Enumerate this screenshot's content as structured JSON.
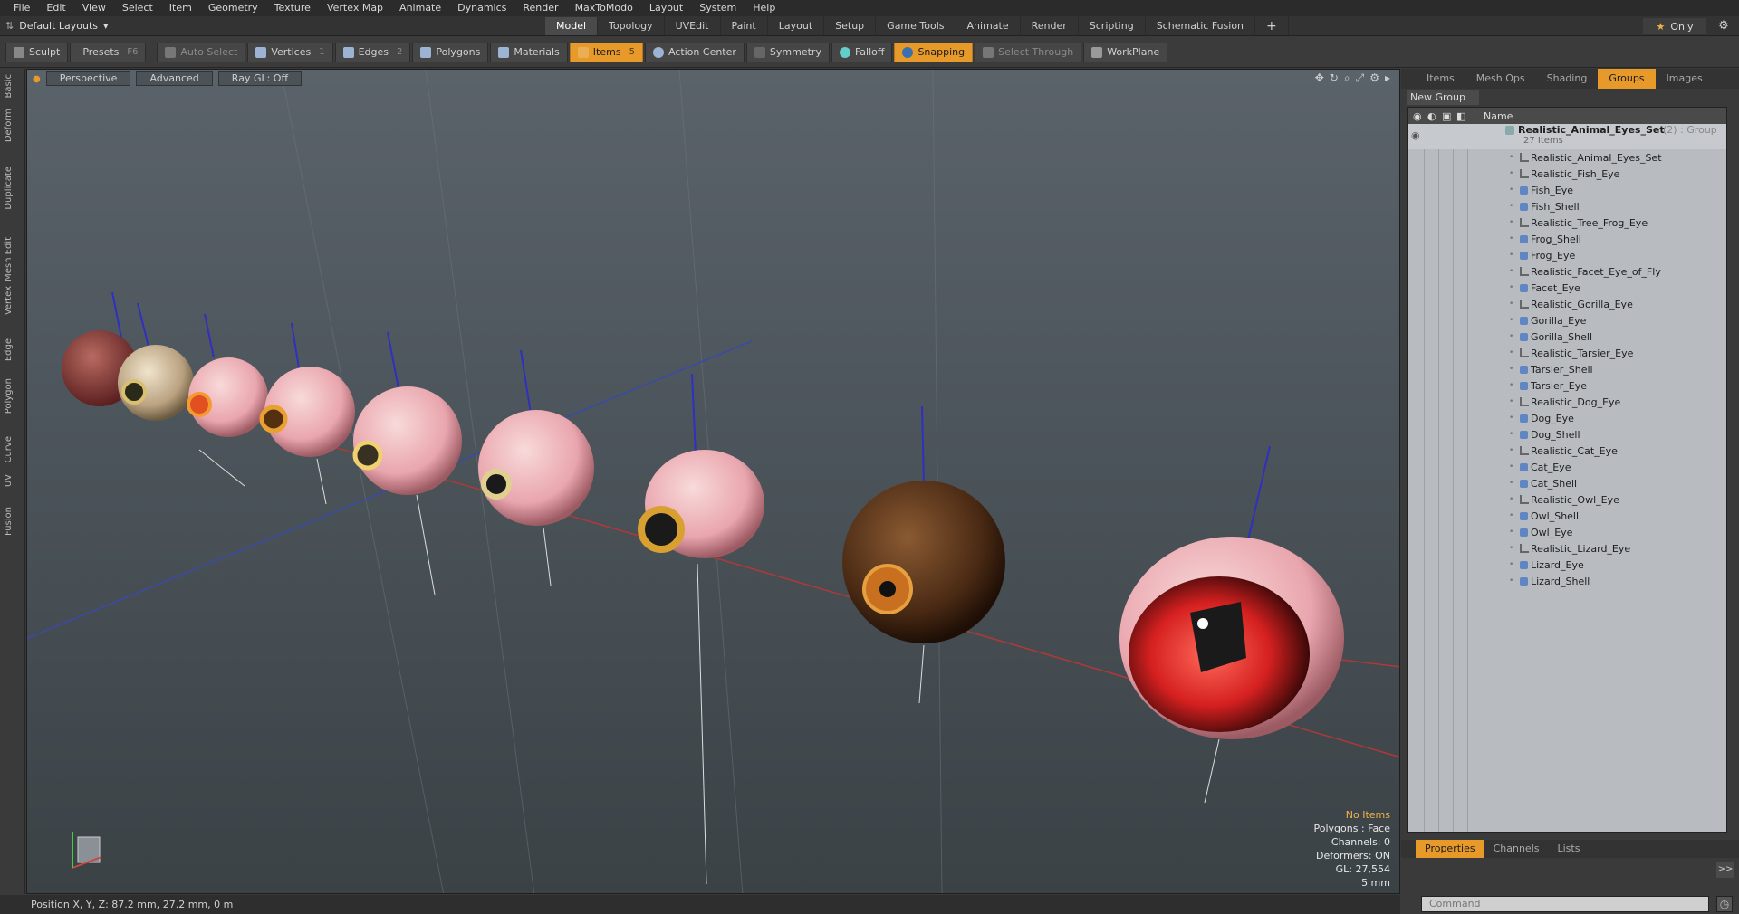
{
  "menu": [
    "File",
    "Edit",
    "View",
    "Select",
    "Item",
    "Geometry",
    "Texture",
    "Vertex Map",
    "Animate",
    "Dynamics",
    "Render",
    "MaxToModo",
    "Layout",
    "System",
    "Help"
  ],
  "layout": {
    "selector": "Default Layouts",
    "tabs": [
      "Model",
      "Topology",
      "UVEdit",
      "Paint",
      "Layout",
      "Setup",
      "Game Tools",
      "Animate",
      "Render",
      "Scripting",
      "Schematic Fusion"
    ],
    "active_tab": "Model",
    "only_label": "Only"
  },
  "toolbar": {
    "sculpt": "Sculpt",
    "presets": "Presets",
    "presets_key": "F6",
    "auto_select": "Auto Select",
    "vertices": "Vertices",
    "vertices_count": "1",
    "edges": "Edges",
    "edges_count": "2",
    "polygons": "Polygons",
    "materials": "Materials",
    "items": "Items",
    "items_count": "5",
    "action_center": "Action Center",
    "symmetry": "Symmetry",
    "falloff": "Falloff",
    "snapping": "Snapping",
    "select_through": "Select Through",
    "workplane": "WorkPlane"
  },
  "left_tabs": [
    "Basic",
    "Deform",
    "Duplicate",
    "Mesh Edit",
    "Vertex",
    "Edge",
    "Polygon",
    "Curve",
    "UV",
    "Fusion"
  ],
  "viewport": {
    "view_mode": "Perspective",
    "shading": "Advanced",
    "raygl": "Ray GL: Off",
    "hud": {
      "items": "No Items",
      "polygons": "Polygons : Face",
      "channels": "Channels: 0",
      "deformers": "Deformers: ON",
      "gl": "GL: 27,554",
      "grid": "5 mm"
    }
  },
  "status": {
    "position": "Position X, Y, Z:   87.2 mm, 27.2 mm, 0 m"
  },
  "right_panel": {
    "tabs": [
      "Items",
      "Mesh Ops",
      "Shading",
      "Groups",
      "Images"
    ],
    "active_tab": "Groups",
    "new_group": "New Group",
    "col_name": "Name",
    "group": {
      "name": "Realistic_Animal_Eyes_Set",
      "count_suffix": "(2) : Group",
      "items_label": "27 Items"
    },
    "items": [
      {
        "name": "Realistic_Animal_Eyes_Set",
        "type": "locator"
      },
      {
        "name": "Realistic_Fish_Eye",
        "type": "locator"
      },
      {
        "name": "Fish_Eye",
        "type": "mesh"
      },
      {
        "name": "Fish_Shell",
        "type": "mesh"
      },
      {
        "name": "Realistic_Tree_Frog_Eye",
        "type": "locator"
      },
      {
        "name": "Frog_Shell",
        "type": "mesh"
      },
      {
        "name": "Frog_Eye",
        "type": "mesh"
      },
      {
        "name": "Realistic_Facet_Eye_of_Fly",
        "type": "locator"
      },
      {
        "name": "Facet_Eye",
        "type": "mesh"
      },
      {
        "name": "Realistic_Gorilla_Eye",
        "type": "locator"
      },
      {
        "name": "Gorilla_Eye",
        "type": "mesh"
      },
      {
        "name": "Gorilla_Shell",
        "type": "mesh"
      },
      {
        "name": "Realistic_Tarsier_Eye",
        "type": "locator"
      },
      {
        "name": "Tarsier_Shell",
        "type": "mesh"
      },
      {
        "name": "Tarsier_Eye",
        "type": "mesh"
      },
      {
        "name": "Realistic_Dog_Eye",
        "type": "locator"
      },
      {
        "name": "Dog_Eye",
        "type": "mesh"
      },
      {
        "name": "Dog_Shell",
        "type": "mesh"
      },
      {
        "name": "Realistic_Cat_Eye",
        "type": "locator"
      },
      {
        "name": "Cat_Eye",
        "type": "mesh"
      },
      {
        "name": "Cat_Shell",
        "type": "mesh"
      },
      {
        "name": "Realistic_Owl_Eye",
        "type": "locator"
      },
      {
        "name": "Owl_Shell",
        "type": "mesh"
      },
      {
        "name": "Owl_Eye",
        "type": "mesh"
      },
      {
        "name": "Realistic_Lizard_Eye",
        "type": "locator"
      },
      {
        "name": "Lizard_Eye",
        "type": "mesh"
      },
      {
        "name": "Lizard_Shell",
        "type": "mesh"
      }
    ],
    "bottom_tabs": [
      "Properties",
      "Channels",
      "Lists"
    ],
    "bottom_active": "Properties",
    "command_placeholder": "Command"
  }
}
